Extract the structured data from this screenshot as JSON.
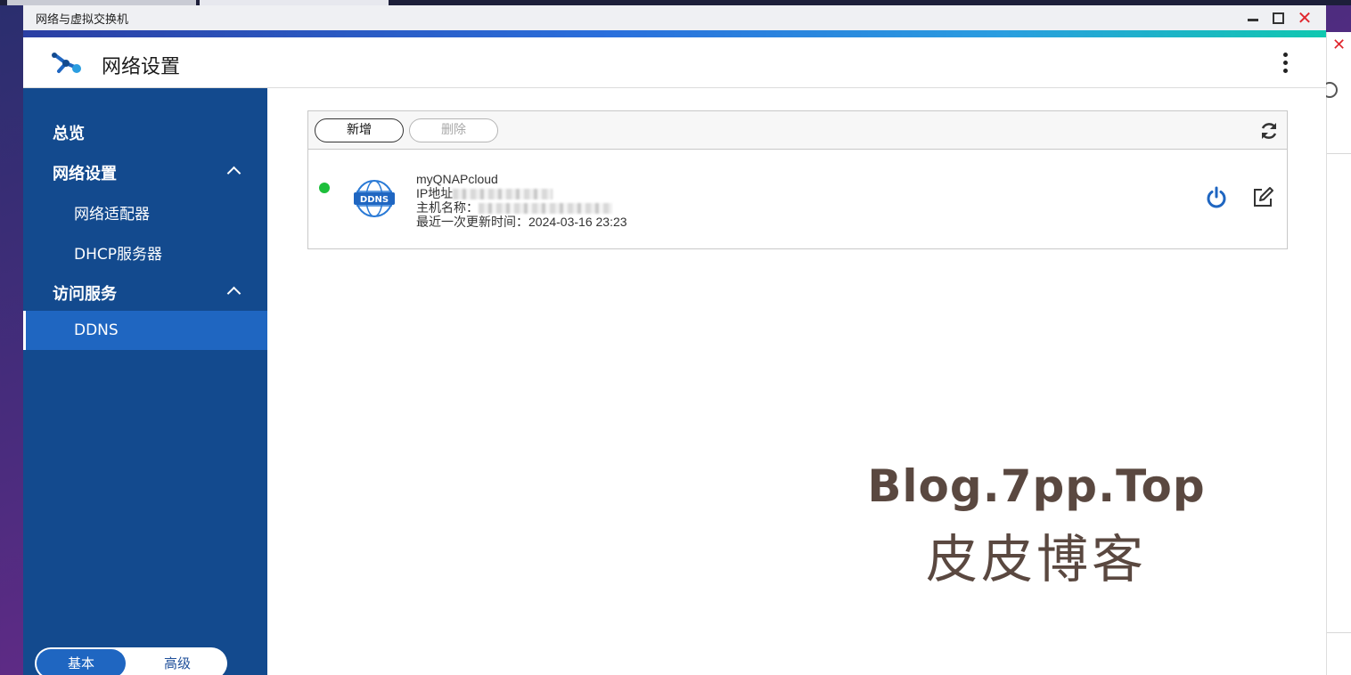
{
  "window": {
    "title": "网络与虚拟交换机",
    "close_glyph": "✕"
  },
  "header": {
    "app_title": "网络设置"
  },
  "sidebar": {
    "items": [
      {
        "label": "总览"
      },
      {
        "label": "网络设置"
      },
      {
        "label": "网络适配器"
      },
      {
        "label": "DHCP服务器"
      },
      {
        "label": "访问服务"
      },
      {
        "label": "DDNS"
      }
    ],
    "active": "DDNS",
    "mode": {
      "basic": "基本",
      "advanced": "高级",
      "selected": "基本"
    }
  },
  "toolbar": {
    "add_label": "新增",
    "delete_label": "删除"
  },
  "ddns_entry": {
    "status_color": "#1dbf3b",
    "icon_text": "DDNS",
    "name": "myQNAPcloud",
    "ip_label": "IP地址",
    "hostname_label": "主机名称：",
    "last_update_label": "最近一次更新时间：",
    "last_update_value": "2024-03-16 23:23"
  },
  "watermark": {
    "line1": "Blog.7pp.Top",
    "line2": "皮皮博客"
  },
  "colors": {
    "sidebar_bg": "#134a8e",
    "sidebar_active": "#1f66c1",
    "accent": "#1f66c1",
    "close_red": "#e0262d"
  }
}
